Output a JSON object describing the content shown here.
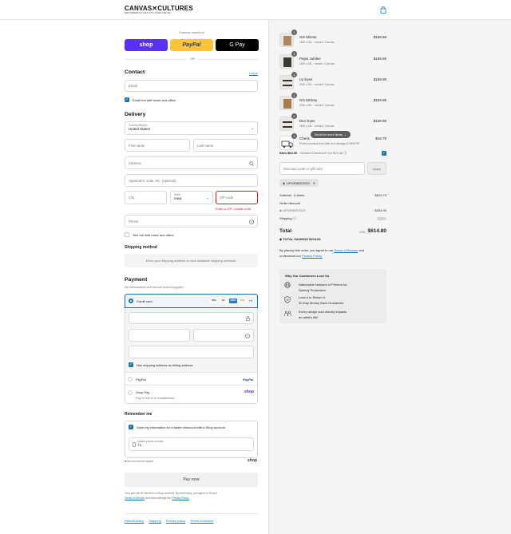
{
  "header": {
    "logo": "CANVAS✕CULTURES",
    "logo_sub": "EMPOWERING ARTISTS WORLDWIDE",
    "bag_icon": "shopping-bag-icon"
  },
  "express": {
    "title": "Express checkout",
    "shop": "shop",
    "paypal": "PayPal",
    "gpay": "G Pay",
    "or": "OR"
  },
  "contact": {
    "title": "Contact",
    "login": "Log in",
    "email_placeholder": "Email",
    "email_news": "Email me with news and offers"
  },
  "delivery": {
    "title": "Delivery",
    "country_label": "Country/Region",
    "country_value": "United States",
    "first_name": "First name",
    "last_name": "Last name",
    "address": "Address",
    "apartment": "Apartment, suite, etc. (optional)",
    "city": "City",
    "state_label": "State",
    "state_value": "Iowa",
    "zip": "ZIP code",
    "zip_error": "Enter a ZIP / postal code",
    "phone": "Phone",
    "text_news": "Text me with news and offers"
  },
  "shipping_method": {
    "title": "Shipping method",
    "note": "Enter your shipping address to view available shipping methods."
  },
  "payment": {
    "title": "Payment",
    "subtitle": "All transactions are secure and encrypted.",
    "credit_card": "Credit card",
    "cards": [
      "VISA",
      "MC",
      "AMEX",
      "DISC"
    ],
    "cards_more": "+4",
    "billing_same": "Use shipping address as billing address",
    "paypal": "PayPal",
    "paypal_logo": "PayPal",
    "shop_pay": "Shop Pay",
    "shop_pay_sub": "Pay in full or in installments",
    "shop_logo": "shop"
  },
  "remember": {
    "title": "Remember me",
    "save_info": "Save my information for a faster checkout with a Shop account",
    "mobile_label": "Mobile phone number",
    "mobile_value": "+1",
    "secure": "Secure and encrypted",
    "shop_logo": "shop"
  },
  "pay_now": "Pay now",
  "legal": {
    "text1": "Your info will be saved to a Shop account. By continuing, you agree to Shop's",
    "terms": "Terms of Service",
    "text2": "and acknowledge the",
    "privacy": "Privacy Policy."
  },
  "footer": [
    "Refund policy",
    "Shipping",
    "Privacy policy",
    "Terms of service"
  ],
  "items": [
    {
      "name": "GG Minnie",
      "variant": "16W x 24L · Inches / Canvas",
      "price": "$159.99",
      "qty": "1",
      "color": "#b08560"
    },
    {
      "name": "Pepsi Jubilee",
      "variant": "16W x 24L · Inches / Canvas",
      "price": "$159.99",
      "qty": "1",
      "color": "#3a3a3a"
    },
    {
      "name": "LV Eyes",
      "variant": "20W x 20L · Inches / Canvas",
      "price": "$159.99",
      "qty": "1",
      "color": "#e9e6e1"
    },
    {
      "name": "GG Mickey",
      "variant": "20W x 20L · Inches / Canvas",
      "price": "$159.99",
      "qty": "1",
      "color": "#a87a50"
    },
    {
      "name": "Dior Eyes",
      "variant": "16W x 24L · Inches / Canvas",
      "price": "$159.99",
      "qty": "1",
      "color": "#e9e6e1"
    },
    {
      "name": "Check",
      "variant": "Protect product from theft and damage (CHEKPRI",
      "price": "$19.78",
      "qty": "1",
      "color": "#ffffff"
    }
  ],
  "scroll_hint": "Scroll for more items",
  "earn": {
    "label": "Earn $60.00",
    "rest": "· Onward Checkout+ for $19.48"
  },
  "discount": {
    "placeholder": "Discount code or gift card",
    "apply": "Apply",
    "tag": "UPGRADE2023"
  },
  "summary": {
    "subtotal_label": "Subtotal · 6 items",
    "subtotal": "$819.73",
    "order_discount": "Order discount",
    "code": "UPGRADE2023",
    "discount_value": "- $204.93",
    "shipping_label": "Shipping",
    "total_label": "Total",
    "currency": "USD",
    "total": "$614.80",
    "savings_label": "TOTAL SAVINGS",
    "savings": "$204.93"
  },
  "agree": {
    "text1": "By placing this order, you agree to our",
    "tos": "Terms of Service",
    "and": "and",
    "text2": "understand our",
    "privacy": "Privacy Policy."
  },
  "why": {
    "title": "Why Our Customers Love Us",
    "points": [
      {
        "l1": "Nationwide Network of Printers for",
        "l2": "Speedy Production"
      },
      {
        "l1": "Love it or Return it.",
        "l2": "30-Day Money Back Guarantee."
      },
      {
        "l1": "Every design sold directly impacts",
        "l2": "an artist's life!"
      }
    ]
  },
  "colors": {
    "accent": "#1773b0",
    "shop": "#5a31f4",
    "paypal": "#ffc439",
    "error": "#dd1d1d"
  }
}
